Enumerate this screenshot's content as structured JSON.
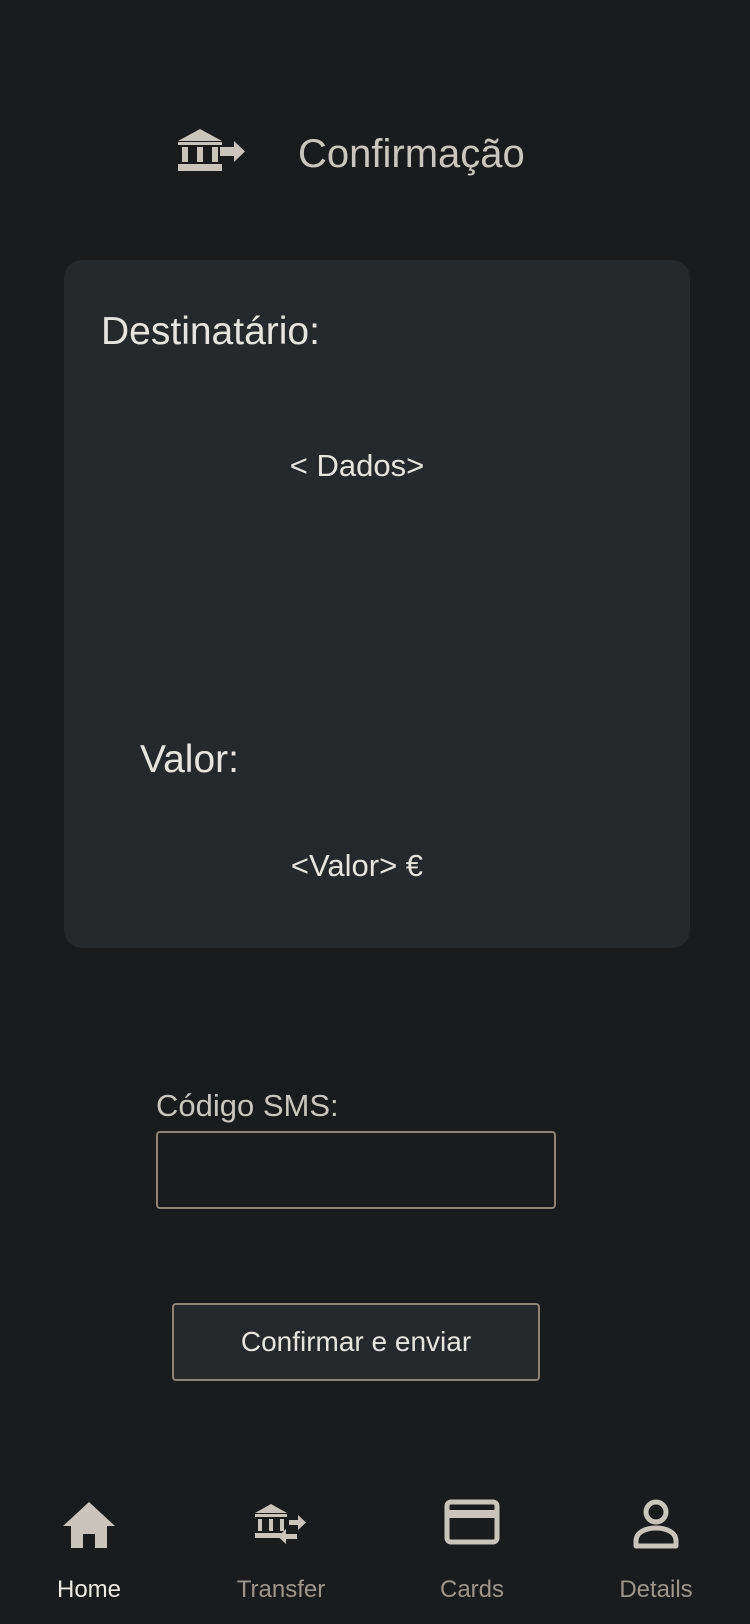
{
  "header": {
    "title": "Confirmação",
    "icon": "bank-transfer-out-icon"
  },
  "card": {
    "recipient_label": "Destinatário:",
    "recipient_value": "< Dados>",
    "amount_label": "Valor:",
    "amount_value": "<Valor> €"
  },
  "sms": {
    "label": "Código SMS:",
    "value": ""
  },
  "confirm_button": {
    "label": "Confirmar e enviar"
  },
  "nav": {
    "items": [
      {
        "label": "Home",
        "icon": "home-icon",
        "active": true
      },
      {
        "label": "Transfer",
        "icon": "bank-transfer-icon",
        "active": false
      },
      {
        "label": "Cards",
        "icon": "credit-card-icon",
        "active": false
      },
      {
        "label": "Details",
        "icon": "account-icon",
        "active": false
      }
    ]
  },
  "colors": {
    "background": "#1a1b1d",
    "card": "#26292b",
    "text": "#e6e4df",
    "muted_text": "#c9c6c0",
    "icon": "#c9c4bc",
    "border": "#8d8479"
  }
}
